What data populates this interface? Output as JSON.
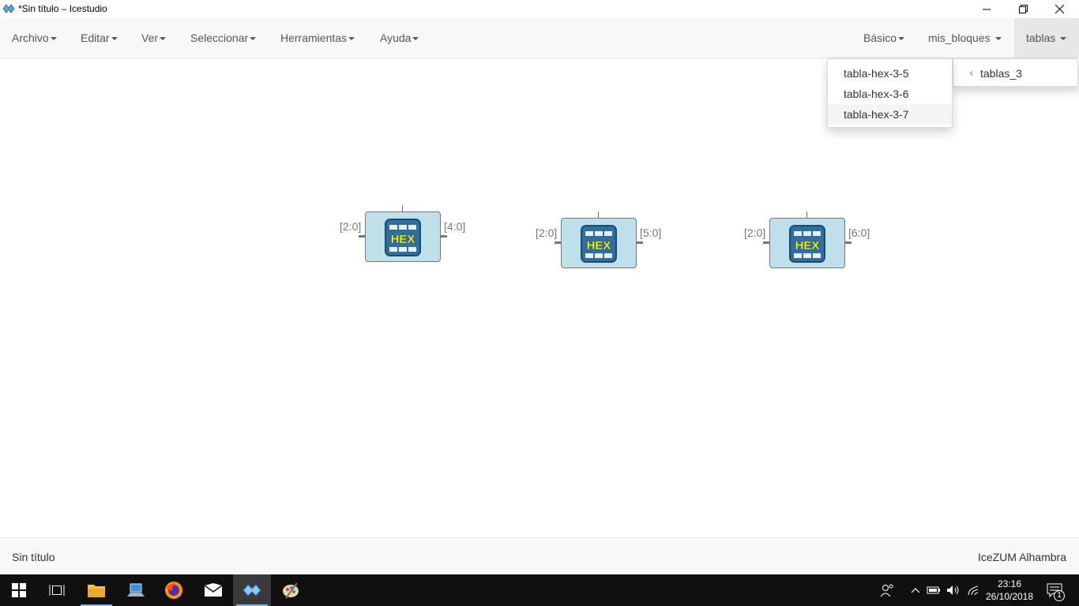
{
  "window": {
    "title": "*Sin título – Icestudio",
    "minimize_glyph": "minimize-icon",
    "maximize_glyph": "restore-icon",
    "close_glyph": "close-icon"
  },
  "menubar": {
    "left": [
      "Archivo",
      "Editar",
      "Ver",
      "Seleccionar",
      "Herramientas",
      "Ayuda"
    ],
    "right": [
      "Básico",
      "mis_bloques",
      "tablas"
    ],
    "active": "tablas"
  },
  "dropdown": {
    "parent_item": "tablas_3",
    "items": [
      "tabla-hex-3-5",
      "tabla-hex-3-6",
      "tabla-hex-3-7"
    ],
    "hovered": "tabla-hex-3-7"
  },
  "canvas": {
    "blocks": [
      {
        "icon_text": "HEX",
        "input_label": "[2:0]",
        "output_label": "[4:0]"
      },
      {
        "icon_text": "HEX",
        "input_label": "[2:0]",
        "output_label": "[5:0]"
      },
      {
        "icon_text": "HEX",
        "input_label": "[2:0]",
        "output_label": "[6:0]"
      }
    ]
  },
  "footer": {
    "filename": "Sin título",
    "board": "IceZUM Alhambra"
  },
  "taskbar": {
    "time": "23:16",
    "date": "26/10/2018",
    "notification_count": "1"
  },
  "colors": {
    "block_fill": "#bfdfea",
    "hex_icon_blue": "#2f6f9f",
    "hex_text_yellow": "#ffff00",
    "taskbar": "#101010"
  }
}
